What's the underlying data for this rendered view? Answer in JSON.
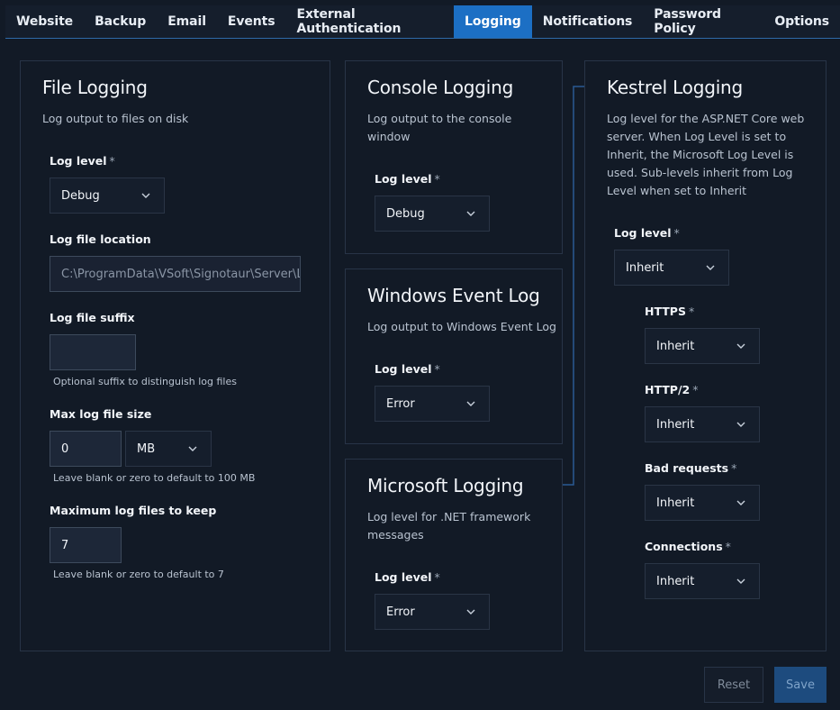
{
  "tabs": [
    "Website",
    "Backup",
    "Email",
    "Events",
    "External Authentication",
    "Logging",
    "Notifications",
    "Password Policy",
    "Options"
  ],
  "active_tab": "Logging",
  "file_logging": {
    "title": "File Logging",
    "description": "Log output to files on disk",
    "log_level_label": "Log level",
    "required_marker": "*",
    "log_level_value": "Debug",
    "location_label": "Log file location",
    "location_value": "C:\\ProgramData\\VSoft\\Signotaur\\Server\\Log",
    "suffix_label": "Log file suffix",
    "suffix_value": "",
    "suffix_hint": "Optional suffix to distinguish log files",
    "max_size_label": "Max log file size",
    "max_size_value": "0",
    "max_size_unit": "MB",
    "max_size_hint": "Leave blank or zero to default to 100 MB",
    "max_files_label": "Maximum log files to keep",
    "max_files_value": "7",
    "max_files_hint": "Leave blank or zero to default to 7"
  },
  "console_logging": {
    "title": "Console Logging",
    "description": "Log output to the console window",
    "log_level_label": "Log level",
    "log_level_value": "Debug"
  },
  "windows_event_log": {
    "title": "Windows Event Log",
    "description": "Log output to Windows Event Log",
    "log_level_label": "Log level",
    "log_level_value": "Error"
  },
  "microsoft_logging": {
    "title": "Microsoft Logging",
    "description": "Log level for .NET framework messages",
    "log_level_label": "Log level",
    "log_level_value": "Error"
  },
  "kestrel_logging": {
    "title": "Kestrel Logging",
    "description": "Log level for the ASP.NET Core web server. When Log Level is set to Inherit, the Microsoft Log Level is used. Sub-levels inherit from Log Level when set to Inherit",
    "log_level_label": "Log level",
    "log_level_value": "Inherit",
    "https_label": "HTTPS",
    "https_value": "Inherit",
    "http2_label": "HTTP/2",
    "http2_value": "Inherit",
    "bad_requests_label": "Bad requests",
    "bad_requests_value": "Inherit",
    "connections_label": "Connections",
    "connections_value": "Inherit"
  },
  "footer": {
    "reset_label": "Reset",
    "save_label": "Save"
  },
  "colors": {
    "background": "#121a26",
    "accent": "#1c6fc4",
    "card_border": "#283447"
  }
}
